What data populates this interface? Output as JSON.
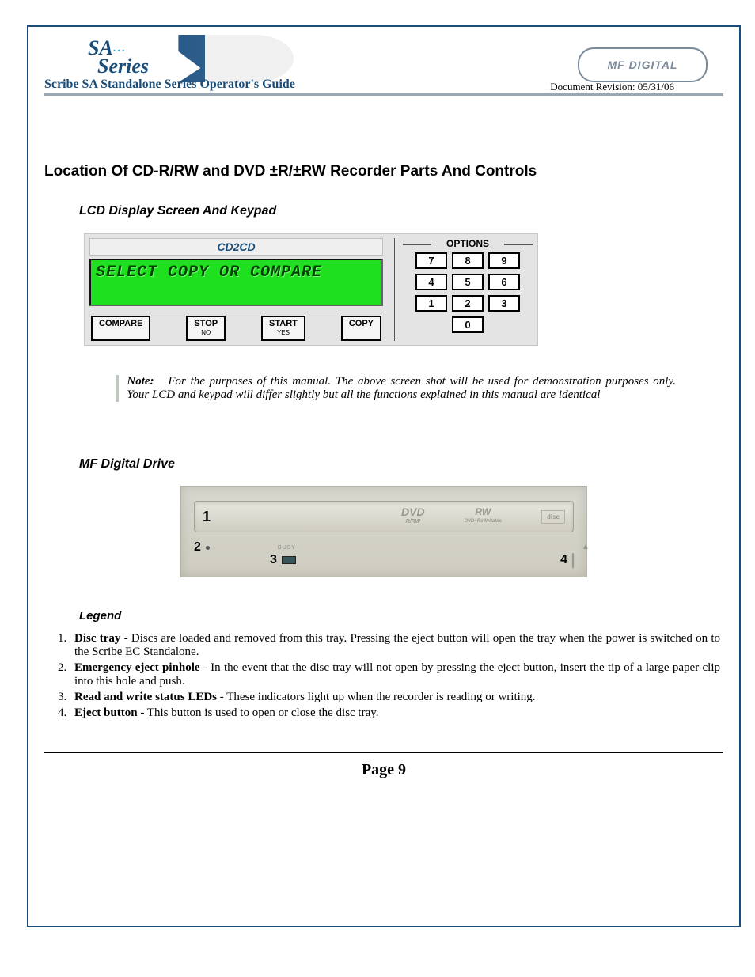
{
  "header": {
    "brand_line1": "SA",
    "brand_line2": "Series",
    "accent": "...",
    "mf_logo_text": "MF DIGITAL",
    "guide_title": "Scribe SA Standalone Series Operator's Guide",
    "doc_revision": "Document Revision: 05/31/06"
  },
  "section_title": "Location Of CD-R/RW and DVD ±R/±RW Recorder Parts And Controls",
  "sub1": "LCD Display Screen And Keypad",
  "lcd": {
    "logo": "CD2CD",
    "screen_text": "SELECT COPY OR COMPARE",
    "btn_compare": "COMPARE",
    "btn_stop": "STOP",
    "btn_stop_sub": "NO",
    "btn_start": "START",
    "btn_start_sub": "YES",
    "btn_copy": "COPY",
    "options_label": "OPTIONS",
    "keys": [
      "7",
      "8",
      "9",
      "4",
      "5",
      "6",
      "1",
      "2",
      "3",
      "0"
    ]
  },
  "note": {
    "label": "Note:",
    "text": "For the purposes of this manual.  The above screen shot will be used for demonstration purposes only.  Your LCD and keypad will differ slightly but all the functions explained in this manual are identical"
  },
  "sub2": "MF Digital Drive",
  "drive": {
    "n1": "1",
    "badge_dvd": "DVD",
    "badge_dvd_sub": "R/RW",
    "badge_rw": "RW",
    "badge_rw_sub": "DVD+ReWritable",
    "badge_disc": "disc",
    "n2": "2",
    "busy": "BUSY",
    "n3": "3",
    "n4": "4"
  },
  "legend_title": "Legend",
  "legend": [
    {
      "term": "Disc tray",
      "desc": " - Discs are loaded and removed from this tray. Pressing the eject button will open the tray when the power is switched on to the Scribe EC Standalone."
    },
    {
      "term": "Emergency eject pinhole",
      "desc": " - In the event that the disc tray will not open by pressing the eject button, insert the tip of a large paper clip into this hole and push."
    },
    {
      "term": "Read and write status LEDs",
      "desc": " - These indicators light up when the recorder is reading or writing."
    },
    {
      "term": "Eject button",
      "desc": " - This button is used to open or close the disc tray."
    }
  ],
  "page_number": "Page 9"
}
